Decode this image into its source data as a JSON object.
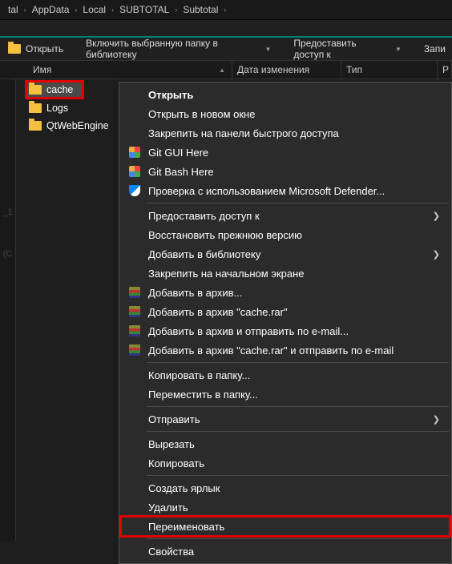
{
  "breadcrumb": {
    "seg0": "tal",
    "seg1": "AppData",
    "seg2": "Local",
    "seg3": "SUBTOTAL",
    "seg4": "Subtotal"
  },
  "toolbar": {
    "open": "Открыть",
    "include_lib": "Включить выбранную папку в библиотеку",
    "share": "Предоставить доступ к",
    "burn": "Запи"
  },
  "columns": {
    "name": "Имя",
    "date": "Дата изменения",
    "type": "Тип",
    "size": "Р"
  },
  "files": {
    "f0": "cache",
    "f1": "Logs",
    "f2": "QtWebEngine"
  },
  "sidebar": {
    "mark1": "_1",
    "mark2": "(С"
  },
  "menu": {
    "open": "Открыть",
    "open_new": "Открыть в новом окне",
    "pin_quick": "Закрепить на панели быстрого доступа",
    "git_gui": "Git GUI Here",
    "git_bash": "Git Bash Here",
    "defender": "Проверка с использованием Microsoft Defender...",
    "give_access": "Предоставить доступ к",
    "restore": "Восстановить прежнюю версию",
    "add_lib": "Добавить в библиотеку",
    "pin_start": "Закрепить на начальном экране",
    "rar_add": "Добавить в архив...",
    "rar_cache": "Добавить в архив \"cache.rar\"",
    "rar_email": "Добавить в архив и отправить по e-mail...",
    "rar_cache_email": "Добавить в архив \"cache.rar\" и отправить по e-mail",
    "copy_to": "Копировать в папку...",
    "move_to": "Переместить в папку...",
    "send_to": "Отправить",
    "cut": "Вырезать",
    "copy": "Копировать",
    "shortcut": "Создать ярлык",
    "delete": "Удалить",
    "rename": "Переименовать",
    "properties": "Свойства"
  }
}
